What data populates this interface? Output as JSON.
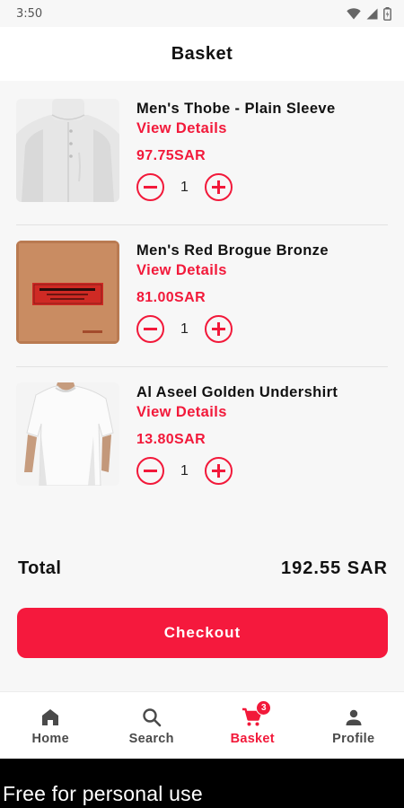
{
  "status_bar": {
    "time": "3:50"
  },
  "header": {
    "title": "Basket"
  },
  "items": [
    {
      "name": "Men's Thobe - Plain Sleeve",
      "details_label": "View Details",
      "price": "97.75SAR",
      "quantity": "1",
      "image": "white-thobe"
    },
    {
      "name": "Men's Red Brogue Bronze",
      "details_label": "View Details",
      "price": "81.00SAR",
      "quantity": "1",
      "image": "brown-box-red-label"
    },
    {
      "name": "Al Aseel Golden Undershirt",
      "details_label": "View Details",
      "price": "13.80SAR",
      "quantity": "1",
      "image": "white-undershirt"
    }
  ],
  "summary": {
    "total_label": "Total",
    "total_value": "192.55 SAR"
  },
  "checkout": {
    "label": "Checkout"
  },
  "nav": {
    "items": [
      {
        "label": "Home",
        "icon": "home-icon"
      },
      {
        "label": "Search",
        "icon": "search-icon"
      },
      {
        "label": "Basket",
        "icon": "cart-icon",
        "active": true,
        "badge": "3"
      },
      {
        "label": "Profile",
        "icon": "person-icon"
      }
    ]
  },
  "watermark": {
    "text": "Free for personal use"
  },
  "colors": {
    "accent": "#f2193a",
    "button": "#f5193d",
    "background": "#f7f7f7"
  }
}
